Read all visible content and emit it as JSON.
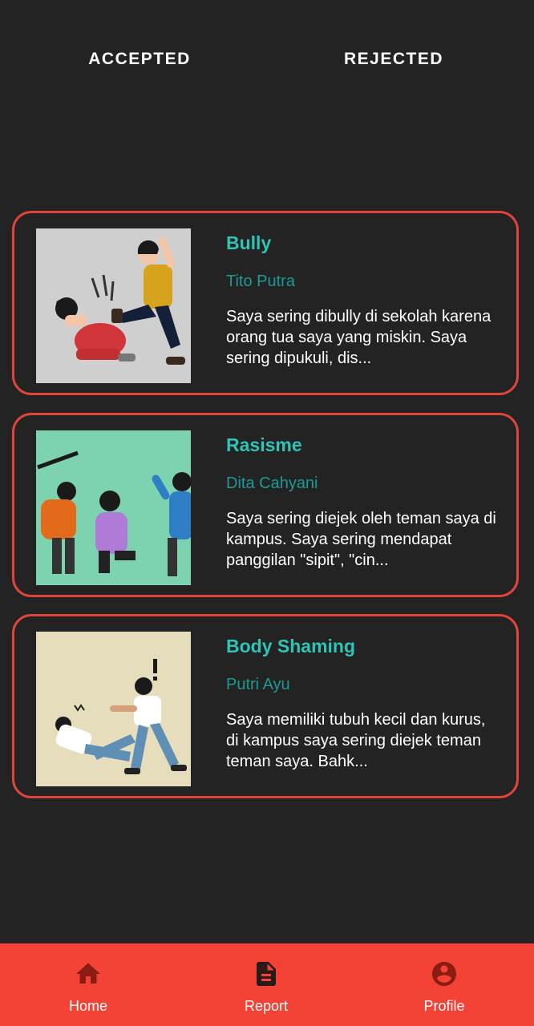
{
  "tabs": {
    "accepted_label": "ACCEPTED",
    "rejected_label": "REJECTED"
  },
  "reports": [
    {
      "title": "Bully",
      "author": "Tito Putra",
      "description": "Saya sering dibully di sekolah karena orang tua saya yang miskin. Saya sering dipukuli, dis..."
    },
    {
      "title": "Rasisme",
      "author": "Dita Cahyani",
      "description": "Saya sering diejek oleh teman saya di kampus. Saya sering mendapat panggilan \"sipit\", \"cin..."
    },
    {
      "title": "Body Shaming",
      "author": "Putri Ayu",
      "description": "Saya memiliki tubuh kecil dan kurus, di kampus saya sering diejek teman teman saya. Bahk..."
    }
  ],
  "bottom_nav": {
    "home_label": "Home",
    "report_label": "Report",
    "profile_label": "Profile"
  },
  "colors": {
    "background": "#232323",
    "card_border": "#e0443a",
    "title": "#2ec4b6",
    "author": "#1d9a93",
    "nav_bar": "#f44336",
    "nav_icon": "#8b1c14"
  },
  "icons": {
    "home": "home-icon",
    "report": "document-icon",
    "profile": "account-circle-icon"
  }
}
